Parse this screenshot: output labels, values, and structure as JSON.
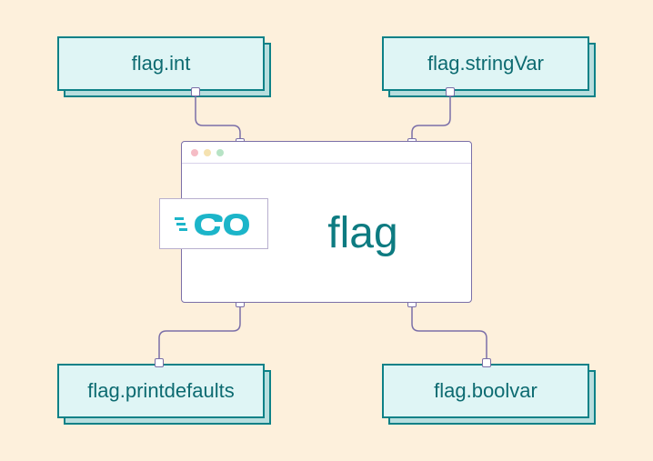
{
  "center": {
    "label": "flag",
    "logo_text": "GO"
  },
  "nodes": {
    "top_left": "flag.int",
    "top_right": "flag.stringVar",
    "bottom_left": "flag.printdefaults",
    "bottom_right": "flag.boolvar"
  },
  "colors": {
    "bg": "#fdf0dc",
    "node_bg": "#dff5f5",
    "node_border": "#0d8187",
    "accent": "#0d7b81"
  }
}
